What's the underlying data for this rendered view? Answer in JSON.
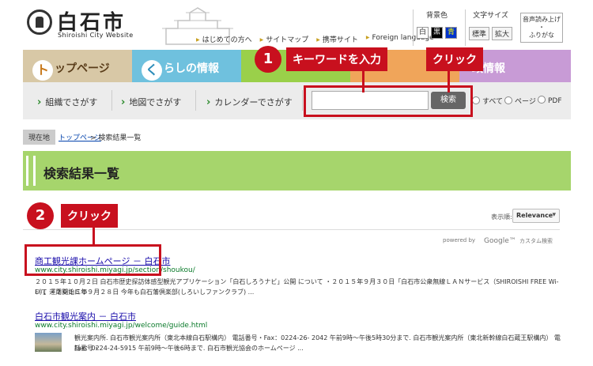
{
  "header": {
    "site_name": "白石市",
    "site_name_en": "Shiroishi City Website",
    "links": [
      "はじめての方へ",
      "サイトマップ",
      "携帯サイト",
      "Foreign language"
    ],
    "bg_color_label": "背景色",
    "bg_colors": [
      "白",
      "黒",
      "青"
    ],
    "font_size_label": "文字サイズ",
    "font_sizes": [
      "標準",
      "拡大"
    ],
    "voice_line1": "音声読み上げ",
    "voice_line2": "・",
    "voice_line3": "ふりがな"
  },
  "main_nav": {
    "top": {
      "icon": "ト",
      "label": "ップページ"
    },
    "life": {
      "icon": "く",
      "label": "らしの情報"
    },
    "gov_label": "政情報"
  },
  "search": {
    "nav": [
      "組織でさがす",
      "地図でさがす",
      "カレンダーでさがす"
    ],
    "input_value": "",
    "button": "検索",
    "radios": [
      "すべて",
      "ページ",
      "PDF"
    ]
  },
  "breadcrumb": {
    "label": "現在地",
    "link": "トップページ",
    "current": "> 検索結果一覧"
  },
  "page_title": "検索結果一覧",
  "results_controls": {
    "display_label": "表示順:",
    "sort_value": "Relevance",
    "powered_by": "powered by",
    "google": "Google™",
    "custom_search": "カスタム検索"
  },
  "results": [
    {
      "title": "商工観光課ホームページ － 白石市",
      "url": "www.city.shiroishi.miyagi.jp/section/shoukou/",
      "snippet_1": "２０１５年１０月２日 白石市歴史探訪体感型観光アプリケーション「白石しろうナビ」公開 について ・２０１５年９月３０日「白石市公衆無線ＬＡＮサービス（SHIROISHI FREE Wi-Fi）」運用開始につ",
      "snippet_2": "いて ・２０１５年９月２８日 今年も白石藩倶楽部(しろいしファンクラブ) ..."
    },
    {
      "title": "白石市観光案内 － 白石市",
      "url": "www.city.shiroishi.miyagi.jp/welcome/guide.html",
      "snippet_1": "観光案内所. 白石市観光案内所（東北本線白石駅構内） 電話番号・Fax：0224-26- 2042 午前9時〜午後5時30分まで. 白石市観光案内所（東北新幹線白石蔵王駅構内） 電話番号・",
      "snippet_2": "Fax：0224-24-5915 午前9時〜午後6時まで. 白石市観光協会のホームページ ..."
    }
  ],
  "annotations": {
    "step1_number": "1",
    "step1_text": "キーワードを入力",
    "step1_click": "クリック",
    "step2_number": "2",
    "step2_text": "クリック"
  },
  "colors": {
    "annotation_red": "#c8101e",
    "title_bar_green": "#a6d56c",
    "link_blue": "#1a0dab",
    "url_green": "#0a7a2a"
  }
}
